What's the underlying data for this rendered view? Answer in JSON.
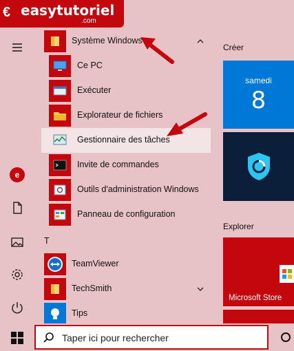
{
  "watermark": {
    "text": "easytutoriel",
    "sub": ".com"
  },
  "rail": {
    "icons": [
      "hamburger-icon",
      "document-icon",
      "pictures-icon",
      "settings-icon",
      "power-icon"
    ],
    "avatar_text": "e"
  },
  "app_list": {
    "group_title": "Système Windows",
    "items": [
      {
        "label": "Ce PC",
        "icon": "computer-icon"
      },
      {
        "label": "Exécuter",
        "icon": "run-icon"
      },
      {
        "label": "Explorateur de fichiers",
        "icon": "folder-icon"
      },
      {
        "label": "Gestionnaire des tâches",
        "icon": "task-manager-icon"
      },
      {
        "label": "Invite de commandes",
        "icon": "command-prompt-icon"
      },
      {
        "label": "Outils d'administration Windows",
        "icon": "admin-tools-icon"
      },
      {
        "label": "Panneau de configuration",
        "icon": "control-panel-icon"
      }
    ],
    "section_letter": "T",
    "t_items": [
      {
        "label": "TeamViewer",
        "icon": "teamviewer-icon"
      },
      {
        "label": "TechSmith",
        "icon": "folder-icon"
      },
      {
        "label": "Tips",
        "icon": "lightbulb-icon"
      }
    ]
  },
  "tiles": {
    "create_title": "Créer",
    "calendar_day": "samedi",
    "calendar_date": "8",
    "explore_title": "Explorer",
    "store_label": "Microsoft Store"
  },
  "taskbar": {
    "search_placeholder": "Taper ici pour rechercher"
  },
  "colors": {
    "accent": "#c4070d",
    "background": "#e7c2c6",
    "highlight": "#f3e5e6",
    "calendar_tile": "#0078d7",
    "hotspot_tile": "#0b1f3a"
  }
}
